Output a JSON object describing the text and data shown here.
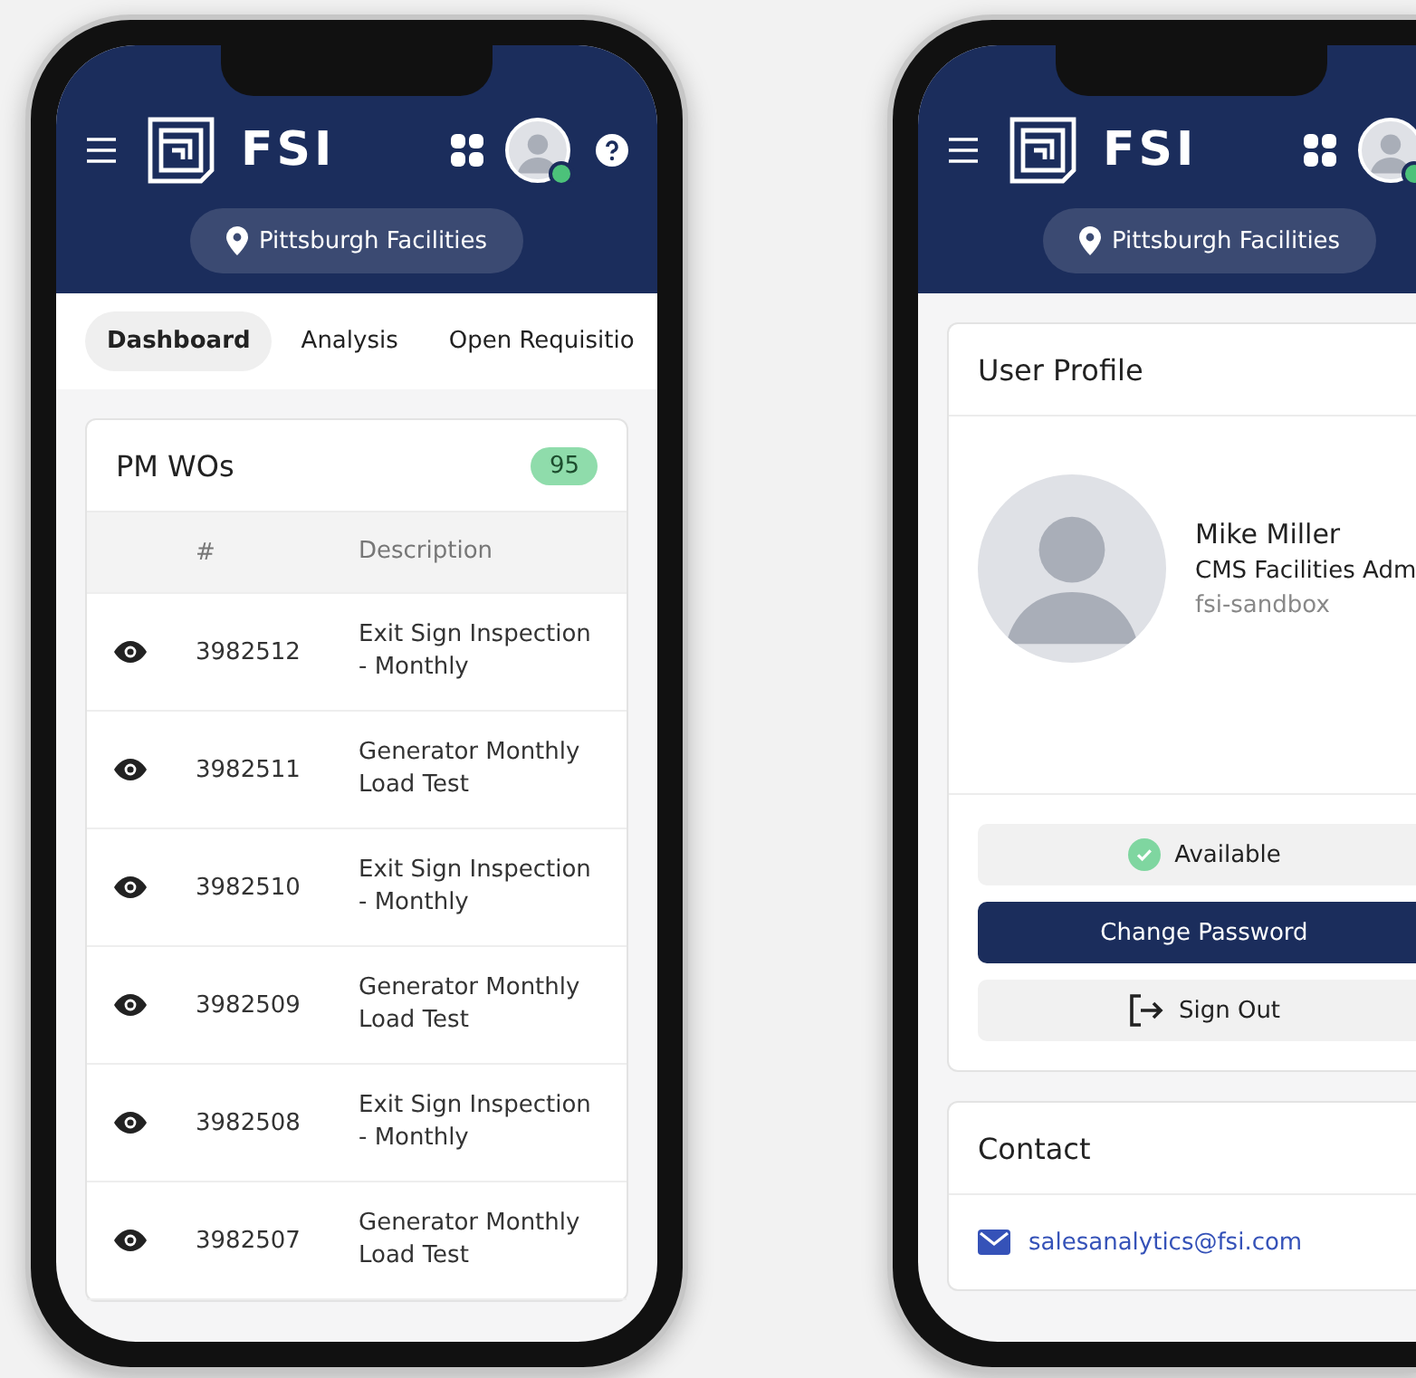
{
  "phones": [
    {
      "kind": "dashboard",
      "header": {
        "brand": "FSI",
        "location": "Pittsburgh Facilities",
        "online": true,
        "help": true
      },
      "tabs": [
        {
          "label": "Dashboard",
          "selected": true
        },
        {
          "label": "Analysis",
          "selected": false
        },
        {
          "label": "Open Requisitio",
          "selected": false
        }
      ],
      "card": {
        "title": "PM WOs",
        "count": "95",
        "columns": [
          "#",
          "Description"
        ],
        "rows": [
          {
            "id": "3982512",
            "description": "Exit Sign Inspection - Monthly"
          },
          {
            "id": "3982511",
            "description": "Generator Monthly Load Test"
          },
          {
            "id": "3982510",
            "description": "Exit Sign Inspection - Monthly"
          },
          {
            "id": "3982509",
            "description": "Generator Monthly Load Test"
          },
          {
            "id": "3982508",
            "description": "Exit Sign Inspection - Monthly"
          },
          {
            "id": "3982507",
            "description": "Generator Monthly Load Test"
          }
        ]
      }
    },
    {
      "kind": "profile",
      "header": {
        "brand": "FSI",
        "location": "Pittsburgh Facilities",
        "online": true,
        "help": false
      },
      "profile": {
        "title": "User Profile",
        "name": "Mike Miller",
        "role": "CMS Facilities Adm",
        "org": "fsi-sandbox",
        "status": "Available",
        "buttons": [
          {
            "label": "Change Password",
            "kind": "primary"
          },
          {
            "label": "Sign Out",
            "kind": "signout"
          }
        ]
      },
      "contact": {
        "title": "Contact",
        "email": "salesanalytics@fsi.com"
      }
    }
  ]
}
